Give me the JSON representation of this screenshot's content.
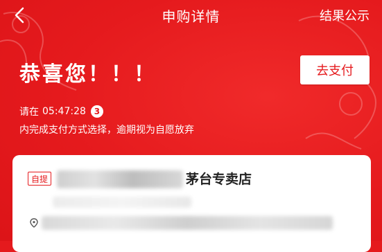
{
  "header": {
    "title": "申购详情",
    "right_action": "结果公示"
  },
  "status": {
    "headline": "恭喜您！！！",
    "time_prefix": "请在",
    "countdown": "05:47:28",
    "step_badge": "3",
    "notice": "内完成支付方式选择，逾期视为自愿放弃"
  },
  "actions": {
    "pay_label": "去支付"
  },
  "store": {
    "tag": "自提",
    "name": "茅台专卖店"
  },
  "colors": {
    "brand_red": "#e51a1d",
    "card_bg": "#ffffff"
  }
}
